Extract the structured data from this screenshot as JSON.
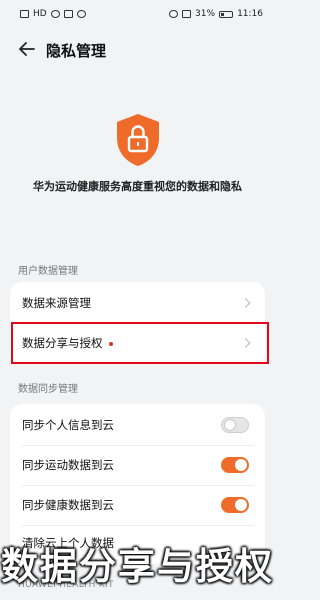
{
  "status_bar": {
    "left_text": "HD",
    "battery": "31%",
    "time": "11:16"
  },
  "header": {
    "title": "隐私管理"
  },
  "hero": {
    "text": "华为运动健康服务高度重视您的数据和隐私"
  },
  "sections": {
    "user_data_label": "用户数据管理",
    "sync_label": "数据同步管理"
  },
  "user_data": {
    "source_label": "数据来源管理",
    "share_label": "数据分享与授权"
  },
  "sync": {
    "items": [
      {
        "label": "同步个人信息到云",
        "on": false
      },
      {
        "label": "同步运动数据到云",
        "on": true
      },
      {
        "label": "同步健康数据到云",
        "on": true
      }
    ],
    "clear_label": "清除云上个人数据"
  },
  "footer": {
    "label": "HUAWEI HEALTH KIT"
  },
  "overlay_caption": "数据分享与授权",
  "colors": {
    "accent": "#ee6b2a",
    "highlight": "#e0081a",
    "background": "#f1f3f5"
  }
}
